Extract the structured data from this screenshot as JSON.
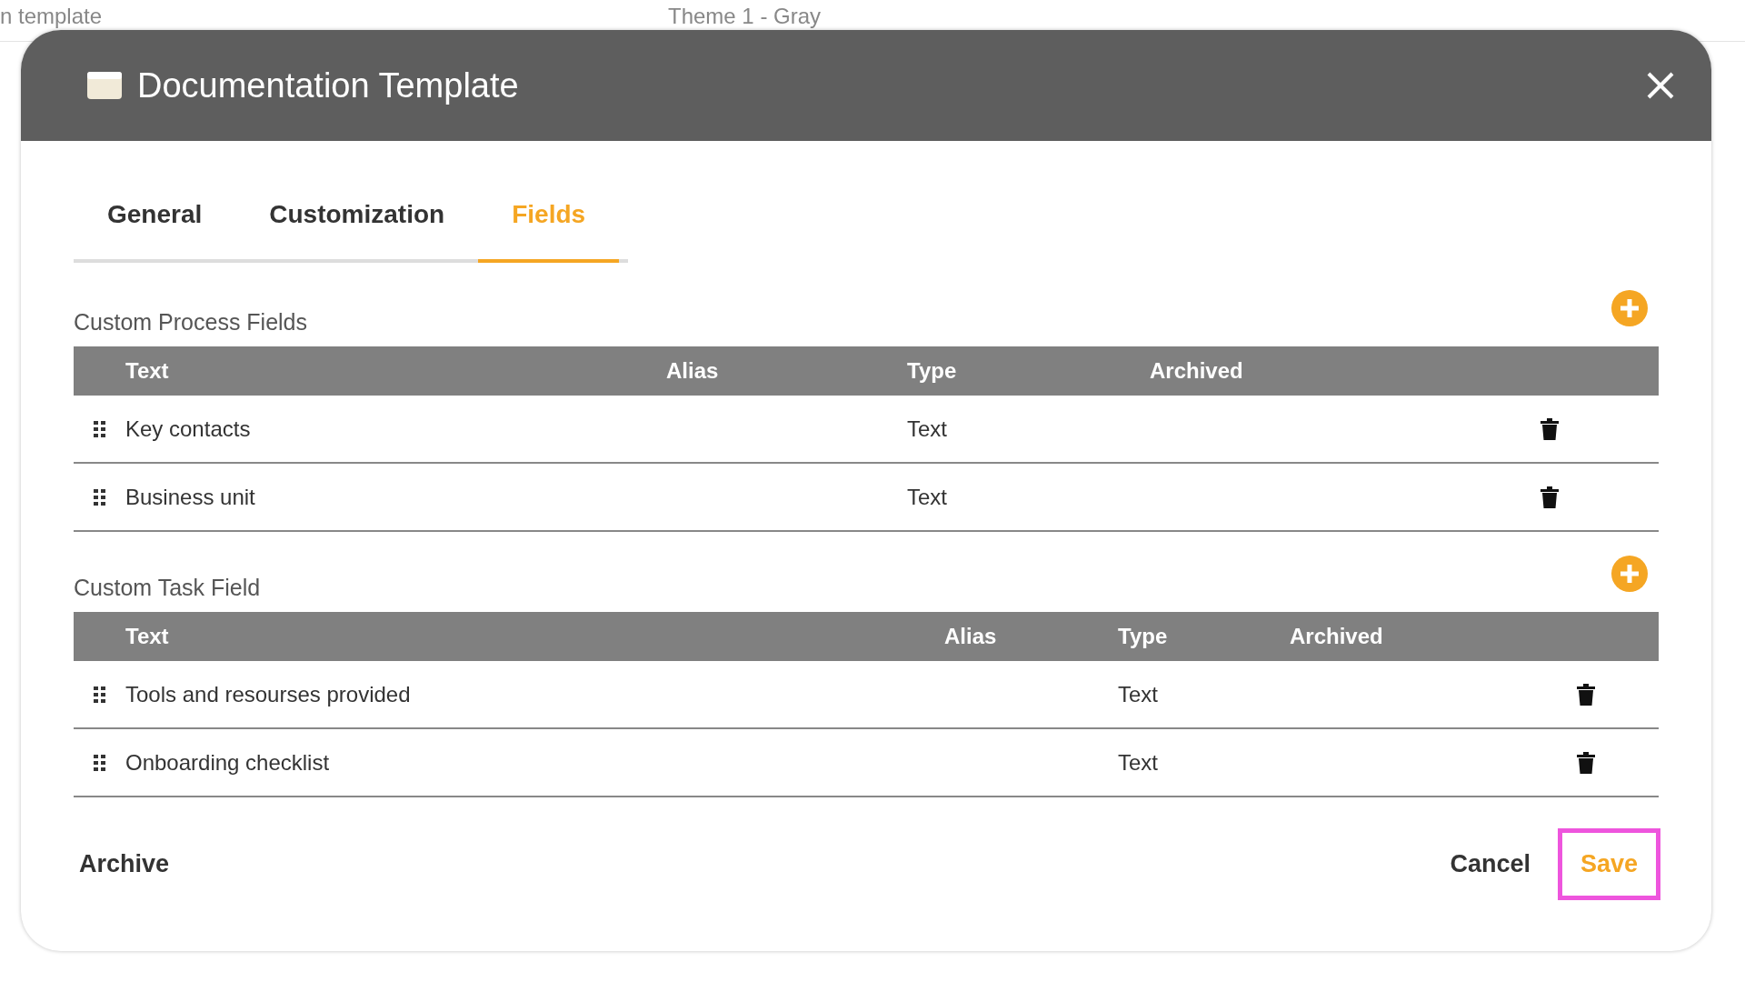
{
  "background_page": {
    "texts": [
      "n template",
      "Theme 1 - Gray"
    ]
  },
  "dialog": {
    "title": "Documentation Template",
    "tabs": [
      {
        "label": "General",
        "selected": false
      },
      {
        "label": "Customization",
        "selected": false
      },
      {
        "label": "Fields",
        "selected": true
      }
    ],
    "sections": [
      {
        "title": "Custom Process Fields",
        "columns": [
          "Text",
          "Alias",
          "Type",
          "Archived"
        ],
        "rows": [
          {
            "text": "Key contacts",
            "type": "Text"
          },
          {
            "text": "Business unit",
            "type": "Text"
          }
        ]
      },
      {
        "title": "Custom Task Field",
        "columns": [
          "Text",
          "Alias",
          "Type",
          "Archived"
        ],
        "rows": [
          {
            "text": "Tools and resourses provided",
            "type": "Text"
          },
          {
            "text": "Onboarding checklist",
            "type": "Text"
          }
        ]
      }
    ],
    "footer": {
      "archive": "Archive",
      "cancel": "Cancel",
      "save": "Save"
    }
  }
}
